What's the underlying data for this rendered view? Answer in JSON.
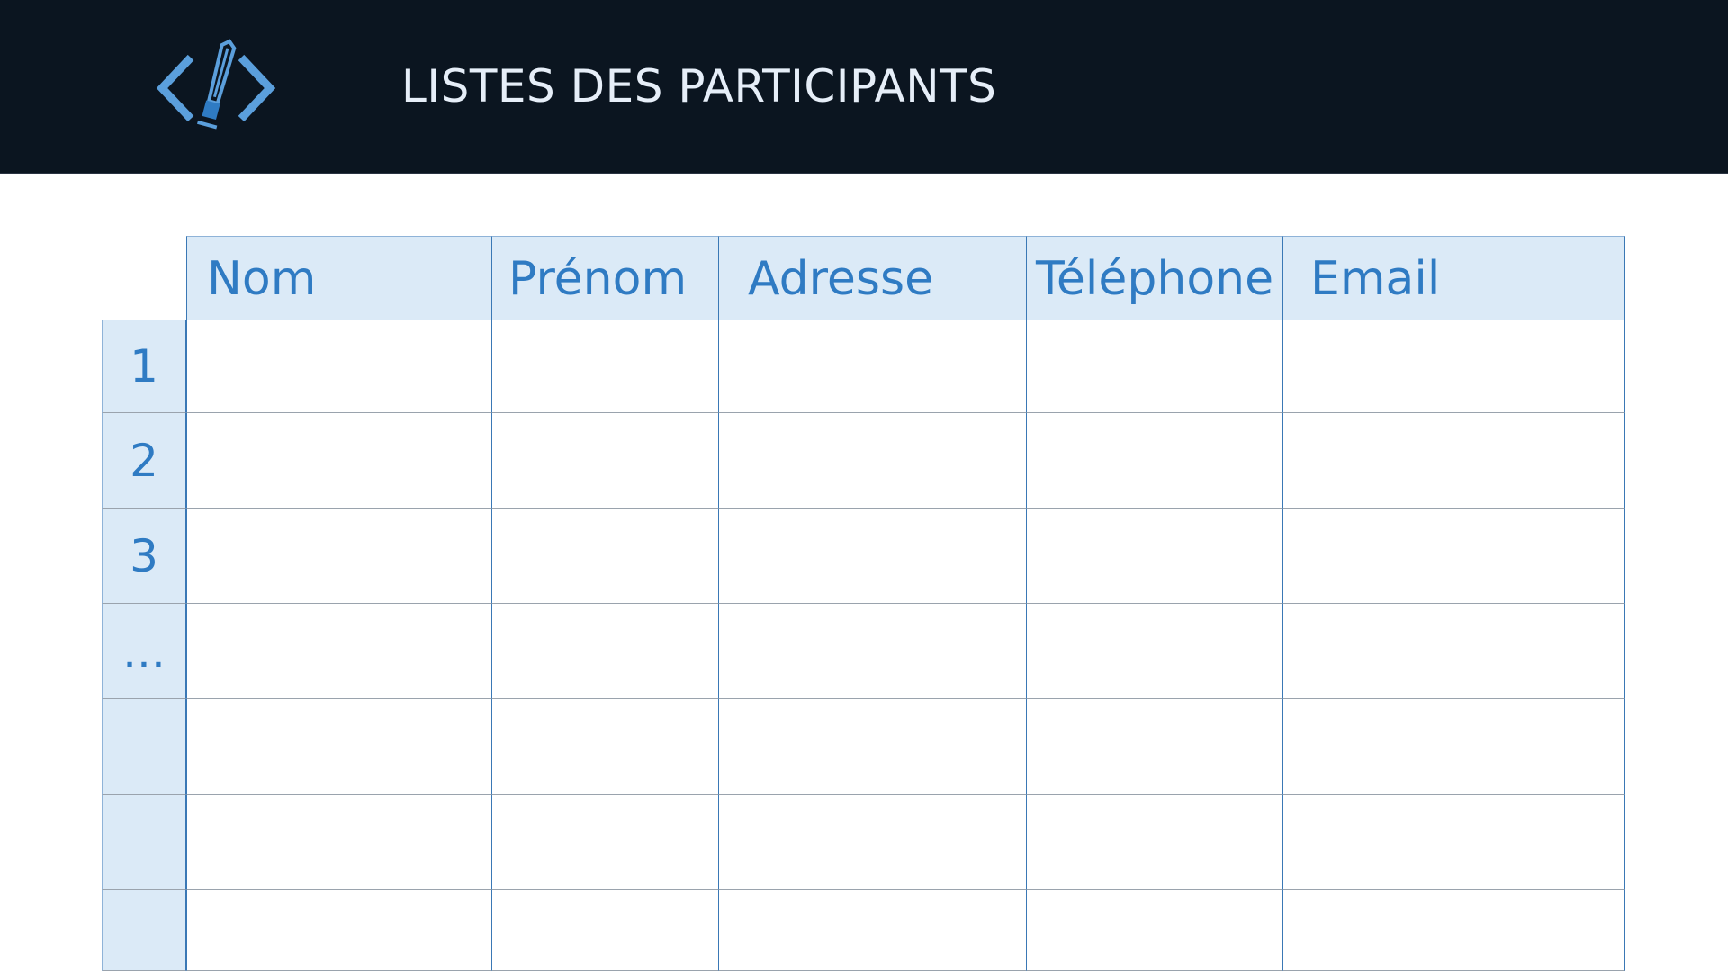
{
  "header": {
    "title": "LISTES DES PARTICIPANTS",
    "logo_icon": "code-pen-icon",
    "background_color": "#0b1520",
    "title_color": "#e6eef8",
    "logo_color": "#5b9fdc"
  },
  "table": {
    "columns": [
      "Nom",
      "Prénom",
      "Adresse",
      "Téléphone",
      "Email"
    ],
    "row_labels": [
      "1",
      "2",
      "3",
      "...",
      "",
      "",
      ""
    ],
    "rows": [
      [
        "",
        "",
        "",
        "",
        ""
      ],
      [
        "",
        "",
        "",
        "",
        ""
      ],
      [
        "",
        "",
        "",
        "",
        ""
      ],
      [
        "",
        "",
        "",
        "",
        ""
      ],
      [
        "",
        "",
        "",
        "",
        ""
      ],
      [
        "",
        "",
        "",
        "",
        ""
      ],
      [
        "",
        "",
        "",
        "",
        ""
      ]
    ],
    "header_fill_color": "#dbeaf7",
    "border_color": "#3a78b5",
    "text_color": "#2f7bc3"
  }
}
